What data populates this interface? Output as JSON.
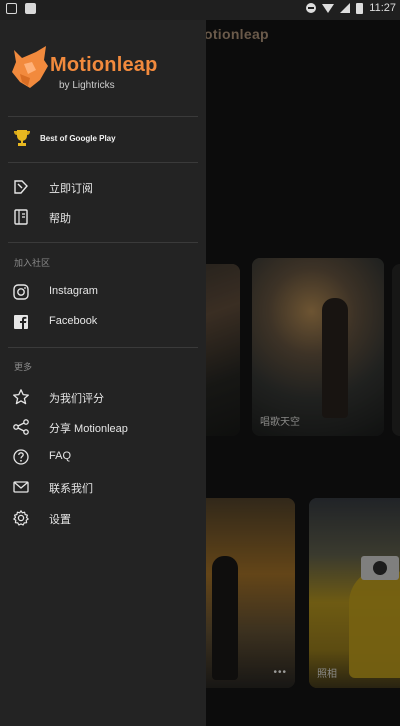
{
  "status_bar": {
    "time": "11:27"
  },
  "background": {
    "title": "Motionleap",
    "cards": [
      {
        "caption": ""
      },
      {
        "caption": "唱歌天空"
      },
      {
        "caption": ""
      },
      {
        "caption": ""
      },
      {
        "caption": "照相"
      }
    ]
  },
  "drawer": {
    "brand": {
      "name": "Motionleap",
      "subtitle": "by Lightricks"
    },
    "award": {
      "label": "Best of Google Play",
      "icon": "trophy-icon"
    },
    "menu_top": [
      {
        "label": "立即订阅",
        "icon": "subscribe-icon"
      },
      {
        "label": "帮助",
        "icon": "book-icon"
      }
    ],
    "section_community": {
      "title": "加入社区"
    },
    "menu_community": [
      {
        "label": "Instagram",
        "icon": "instagram-icon"
      },
      {
        "label": "Facebook",
        "icon": "facebook-icon"
      }
    ],
    "section_more": {
      "title": "更多"
    },
    "menu_more": [
      {
        "label": "为我们评分",
        "icon": "star-icon"
      },
      {
        "label": "分享 Motionleap",
        "icon": "share-icon"
      },
      {
        "label": "FAQ",
        "icon": "help-circle-icon"
      },
      {
        "label": "联系我们",
        "icon": "mail-icon"
      },
      {
        "label": "设置",
        "icon": "gear-icon"
      }
    ]
  },
  "colors": {
    "accent": "#f28a3d",
    "drawer_bg": "#232323",
    "text": "#e6e6e6"
  }
}
